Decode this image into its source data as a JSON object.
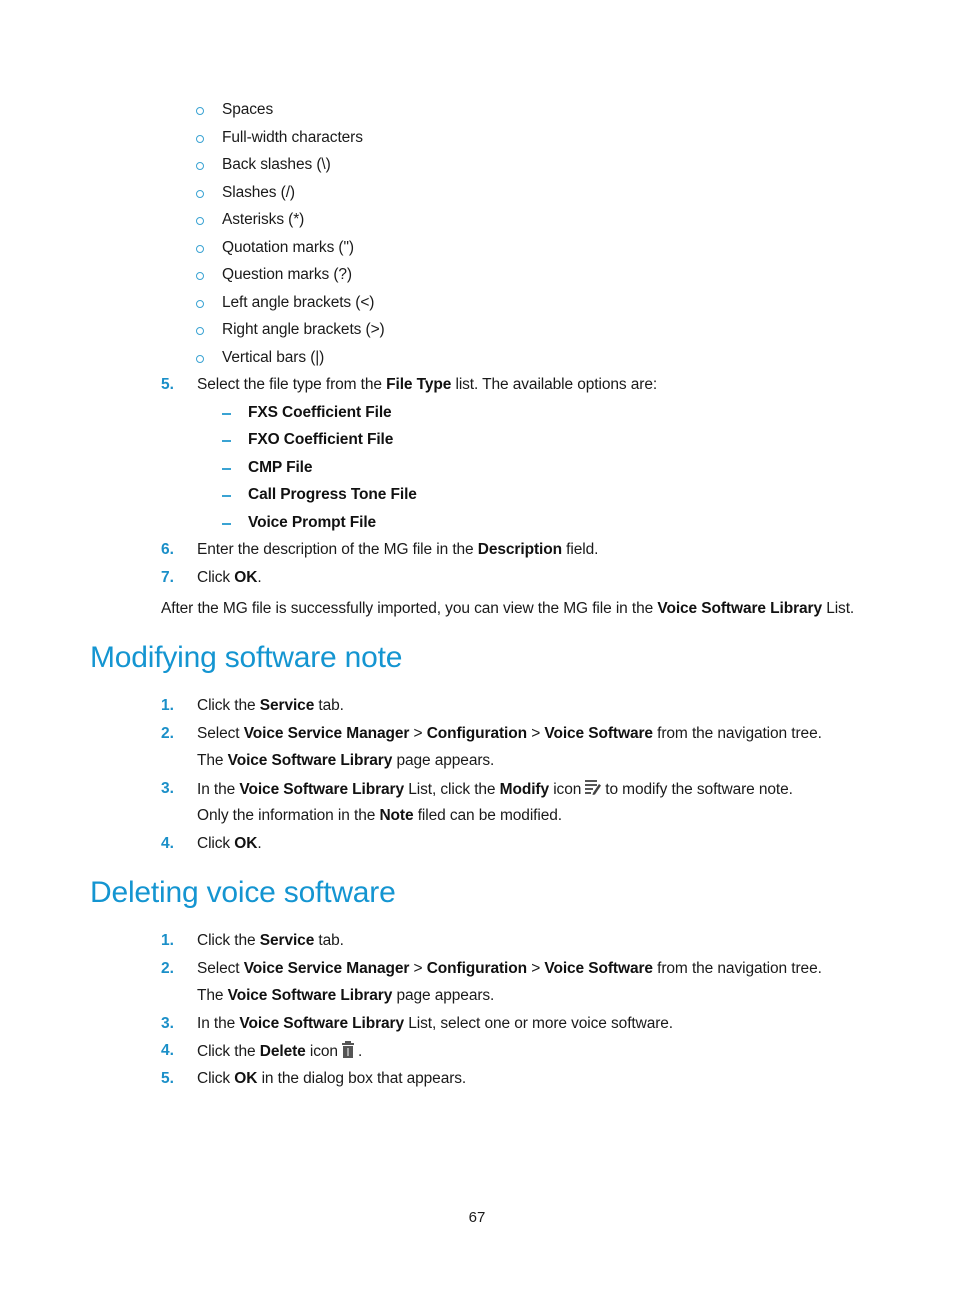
{
  "char_list": [
    "Spaces",
    "Full-width characters",
    "Back slashes (\\)",
    "Slashes (/)",
    "Asterisks (*)",
    "Quotation marks (\")",
    "Question marks (?)",
    "Left angle brackets (<)",
    "Right angle brackets (>)",
    "Vertical bars (|)"
  ],
  "import_steps": {
    "step5": {
      "num": "5.",
      "pre": "Select the file type from the ",
      "bold": "File Type",
      "post": " list. The available options are:"
    },
    "file_types": [
      "FXS Coefficient File",
      "FXO Coefficient File",
      "CMP File",
      "Call Progress Tone File",
      "Voice Prompt File"
    ],
    "step6": {
      "num": "6.",
      "pre": "Enter the description of the MG file in the ",
      "bold": "Description",
      "post": " field."
    },
    "step7": {
      "num": "7.",
      "pre": "Click ",
      "bold": "OK",
      "post": "."
    },
    "after_note": {
      "pre": "After the MG file is successfully imported, you can view the MG file in the ",
      "bold": "Voice Software Library",
      "post": " List."
    }
  },
  "modify_section": {
    "title": "Modifying software note",
    "step1": {
      "num": "1.",
      "pre": "Click the ",
      "bold": "Service",
      "post": " tab."
    },
    "step2": {
      "num": "2.",
      "pre": "Select ",
      "b1": "Voice Service Manager",
      "sep1": " > ",
      "b2": "Configuration",
      "sep2": " > ",
      "b3": "Voice Software",
      "post": " from the navigation tree."
    },
    "step2_note": {
      "pre": "The ",
      "bold": "Voice Software Library",
      "post": " page appears."
    },
    "step3": {
      "num": "3.",
      "pre": "In the ",
      "b1": "Voice Software Library",
      "mid": " List, click the ",
      "b2": "Modify",
      "mid2": " icon",
      "icon": "modify-icon",
      "post": "to modify the software note."
    },
    "step3_note": {
      "pre": "Only the information in the ",
      "bold": "Note",
      "post": " filed can be modified."
    },
    "step4": {
      "num": "4.",
      "pre": "Click ",
      "bold": "OK",
      "post": "."
    }
  },
  "delete_section": {
    "title": "Deleting voice software",
    "step1": {
      "num": "1.",
      "pre": "Click the ",
      "bold": "Service",
      "post": " tab."
    },
    "step2": {
      "num": "2.",
      "pre": "Select ",
      "b1": "Voice Service Manager",
      "sep1": " > ",
      "b2": "Configuration",
      "sep2": " > ",
      "b3": "Voice Software",
      "post": " from the navigation tree."
    },
    "step2_note": {
      "pre": "The ",
      "bold": "Voice Software Library",
      "post": " page appears."
    },
    "step3": {
      "num": "3.",
      "pre": "In the ",
      "bold": "Voice Software Library",
      "post": " List, select one or more voice software."
    },
    "step4": {
      "num": "4.",
      "pre": "Click the ",
      "bold": "Delete",
      "mid": " icon",
      "icon": "trash-icon",
      "post": "."
    },
    "step5": {
      "num": "5.",
      "pre": "Click ",
      "bold": "OK",
      "post": " in the dialog box that appears."
    }
  },
  "footer": {
    "page_number": "67"
  },
  "colors": {
    "heading": "#1495d1",
    "step_number": "#1a8fc8",
    "bullet": "#3aa3d3",
    "text": "#1a1a1a"
  }
}
